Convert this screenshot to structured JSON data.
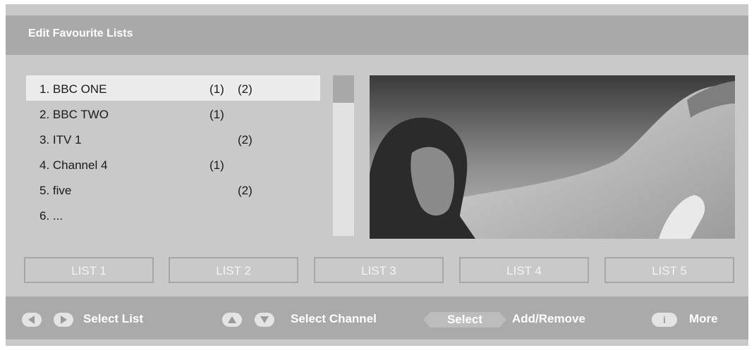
{
  "title": "Edit Favourite Lists",
  "channels": [
    {
      "name": "1. BBC ONE",
      "list1": "(1)",
      "list2": "(2)"
    },
    {
      "name": "2. BBC TWO",
      "list1": "(1)",
      "list2": ""
    },
    {
      "name": "3. ITV 1",
      "list1": "",
      "list2": "(2)"
    },
    {
      "name": "4. Channel 4",
      "list1": "(1)",
      "list2": ""
    },
    {
      "name": "5. five",
      "list1": "",
      "list2": "(2)"
    },
    {
      "name": "6. ...",
      "list1": "",
      "list2": ""
    }
  ],
  "selected_channel_index": 0,
  "tabs": [
    "LIST 1",
    "LIST 2",
    "LIST 3",
    "LIST 4",
    "LIST 5"
  ],
  "footer": {
    "left_arrow_icon": "triangle-left-icon",
    "right_arrow_icon": "triangle-right-icon",
    "select_list": "Select List",
    "up_arrow_icon": "triangle-up-icon",
    "down_arrow_icon": "triangle-down-icon",
    "select_channel": "Select Channel",
    "select_key": "Select",
    "add_remove": "Add/Remove",
    "info_key": "i",
    "more": "More"
  },
  "colors": {
    "panel": "#c9c9c9",
    "header": "#a9a9a9",
    "selected_row": "#ececec",
    "scroll_thumb": "#a8a8a8"
  }
}
